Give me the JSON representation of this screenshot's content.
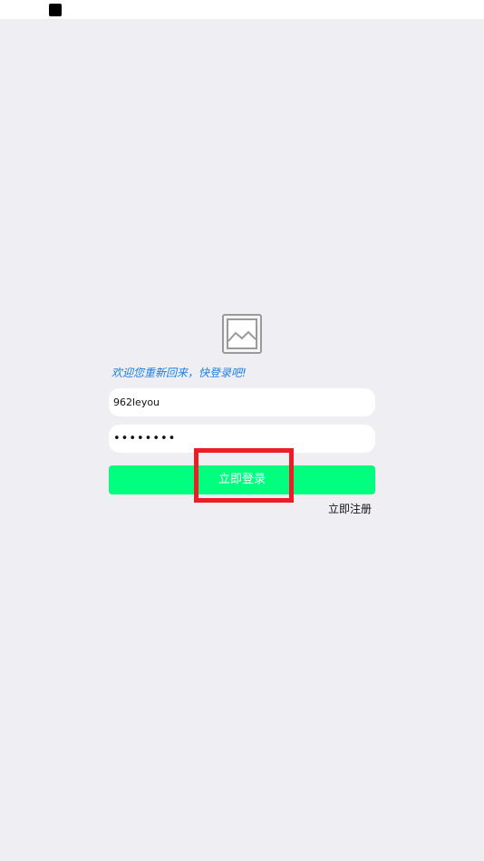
{
  "status_bar": {
    "indicator": "black-square-icon"
  },
  "logo": {
    "icon": "image-placeholder-icon"
  },
  "welcome": {
    "text": "欢迎您重新回来，快登录吧!",
    "color": "#1e7fe0"
  },
  "form": {
    "username_value": "962leyou",
    "password_value": "••••••••"
  },
  "login_button": {
    "label": "立即登录",
    "color": "#00ff7f"
  },
  "register_link": {
    "label": "立即注册"
  },
  "highlight": {
    "color": "#ee1c24"
  }
}
